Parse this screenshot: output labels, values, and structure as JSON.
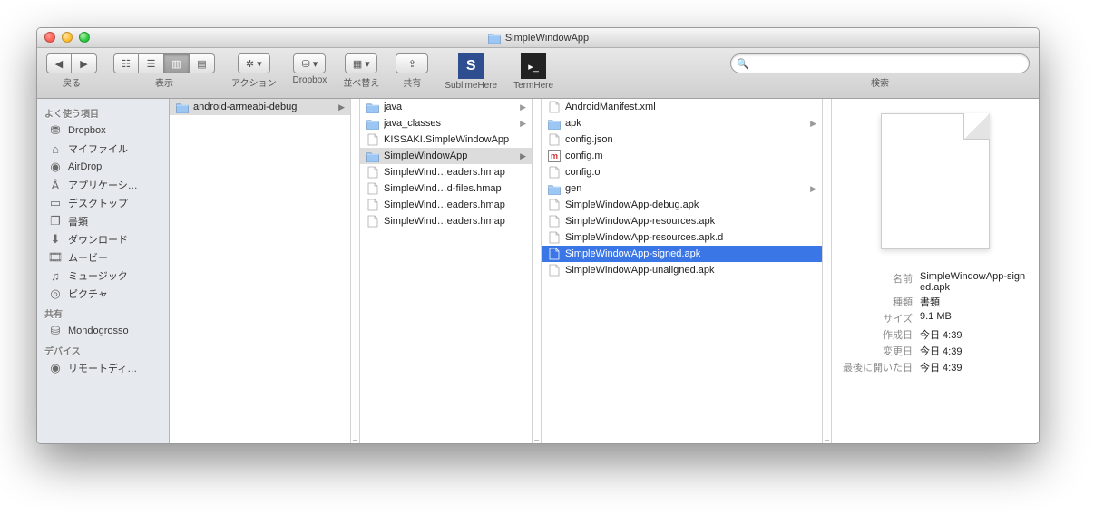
{
  "title": "SimpleWindowApp",
  "toolbar": {
    "back_label": "戻る",
    "view_label": "表示",
    "action_label": "アクション",
    "dropbox_label": "Dropbox",
    "arrange_label": "並べ替え",
    "share_label": "共有",
    "sublime_label": "SublimeHere",
    "term_label": "TermHere",
    "search_label": "検索",
    "search_placeholder": ""
  },
  "sidebar": {
    "sections": [
      {
        "head": "よく使う項目",
        "items": [
          {
            "icon": "dropbox",
            "label": "Dropbox"
          },
          {
            "icon": "home",
            "label": "マイファイル"
          },
          {
            "icon": "airdrop",
            "label": "AirDrop"
          },
          {
            "icon": "apps",
            "label": "アプリケーシ…"
          },
          {
            "icon": "desktop",
            "label": "デスクトップ"
          },
          {
            "icon": "docs",
            "label": "書類"
          },
          {
            "icon": "downloads",
            "label": "ダウンロード"
          },
          {
            "icon": "movies",
            "label": "ムービー"
          },
          {
            "icon": "music",
            "label": "ミュージック"
          },
          {
            "icon": "pictures",
            "label": "ピクチャ"
          }
        ]
      },
      {
        "head": "共有",
        "items": [
          {
            "icon": "hdd",
            "label": "Mondogrosso"
          }
        ]
      },
      {
        "head": "デバイス",
        "items": [
          {
            "icon": "disc",
            "label": "リモートディ…"
          }
        ]
      }
    ]
  },
  "columns": [
    {
      "items": [
        {
          "type": "folder",
          "label": "android-armeabi-debug",
          "has_children": true,
          "selpath": true
        }
      ]
    },
    {
      "items": [
        {
          "type": "folder",
          "label": "java",
          "has_children": true
        },
        {
          "type": "folder",
          "label": "java_classes",
          "has_children": true
        },
        {
          "type": "file",
          "label": "KISSAKI.SimpleWindowApp"
        },
        {
          "type": "folder",
          "label": "SimpleWindowApp",
          "has_children": true,
          "selpath": true
        },
        {
          "type": "file",
          "label": "SimpleWind…eaders.hmap"
        },
        {
          "type": "file",
          "label": "SimpleWind…d-files.hmap"
        },
        {
          "type": "file",
          "label": "SimpleWind…eaders.hmap"
        },
        {
          "type": "file",
          "label": "SimpleWind…eaders.hmap"
        }
      ]
    },
    {
      "items": [
        {
          "type": "file",
          "label": "AndroidManifest.xml"
        },
        {
          "type": "folder",
          "label": "apk",
          "has_children": true
        },
        {
          "type": "file",
          "label": "config.json"
        },
        {
          "type": "mfile",
          "label": "config.m"
        },
        {
          "type": "file",
          "label": "config.o"
        },
        {
          "type": "folder",
          "label": "gen",
          "has_children": true
        },
        {
          "type": "file",
          "label": "SimpleWindowApp-debug.apk"
        },
        {
          "type": "file",
          "label": "SimpleWindowApp-resources.apk"
        },
        {
          "type": "file",
          "label": "SimpleWindowApp-resources.apk.d"
        },
        {
          "type": "file",
          "label": "SimpleWindowApp-signed.apk",
          "selected": true
        },
        {
          "type": "file",
          "label": "SimpleWindowApp-unaligned.apk"
        }
      ]
    }
  ],
  "preview": {
    "name_label": "名前",
    "name_value": "SimpleWindowApp-signed.apk",
    "kind_label": "種類",
    "kind_value": "書類",
    "size_label": "サイズ",
    "size_value": "9.1 MB",
    "created_label": "作成日",
    "created_value": "今日 4:39",
    "modified_label": "変更日",
    "modified_value": "今日 4:39",
    "opened_label": "最後に開いた日",
    "opened_value": "今日 4:39"
  }
}
